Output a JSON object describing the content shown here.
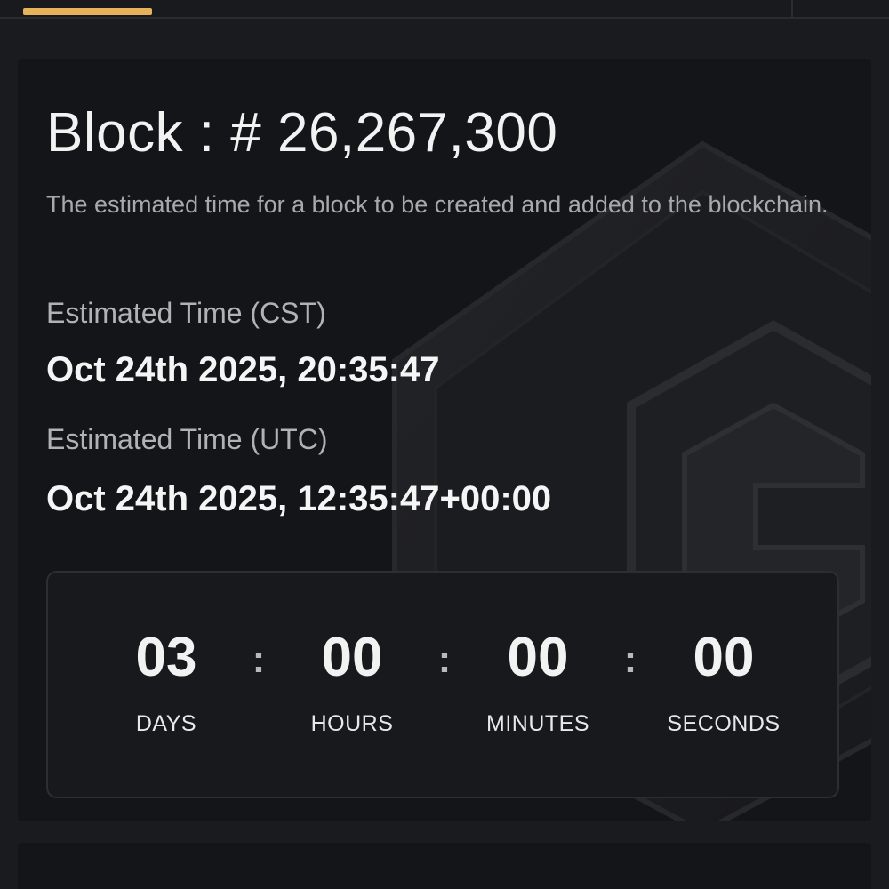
{
  "block": {
    "title_prefix": "Block : ",
    "number": "# 26,267,300",
    "description": "The estimated time for a block to be created and added to the blockchain."
  },
  "estimates": {
    "cst_label": "Estimated Time (CST)",
    "cst_value": "Oct 24th 2025, 20:35:47",
    "utc_label": "Estimated Time (UTC)",
    "utc_value": "Oct 24th 2025, 12:35:47+00:00"
  },
  "countdown": {
    "separator": ":",
    "units": [
      {
        "value": "03",
        "label": "DAYS"
      },
      {
        "value": "00",
        "label": "HOURS"
      },
      {
        "value": "00",
        "label": "MINUTES"
      },
      {
        "value": "00",
        "label": "SECONDS"
      }
    ]
  },
  "colors": {
    "accent": "#e6b35a",
    "background": "#1a1b1f",
    "card": "#141518"
  },
  "icons": {
    "background_logo": "hexagon-shield-logo-icon"
  }
}
